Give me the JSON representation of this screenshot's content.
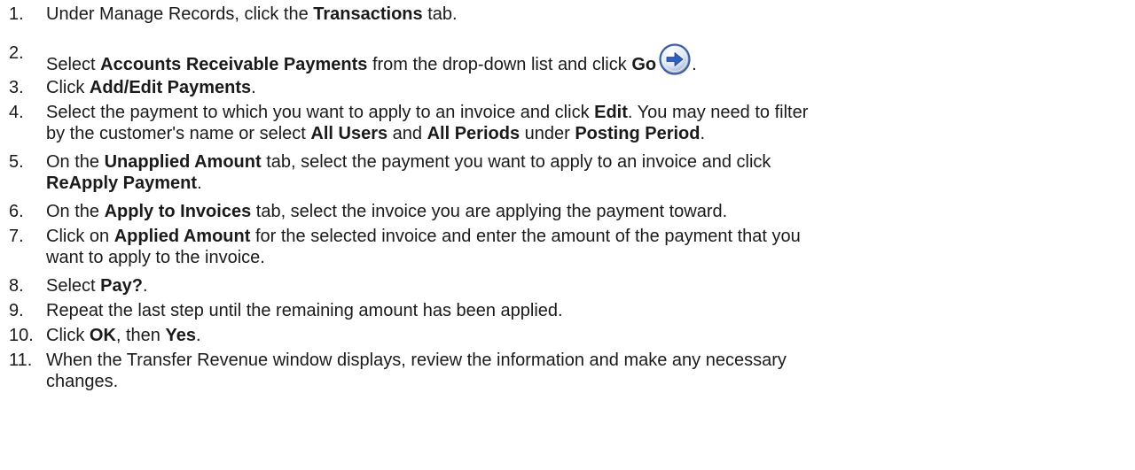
{
  "steps": [
    {
      "num": "1.",
      "lines": [
        [
          {
            "t": "Under Manage Records, click the "
          },
          {
            "t": "Transactions",
            "b": true
          },
          {
            "t": " tab."
          }
        ]
      ]
    },
    {
      "num": "2.",
      "lines": [
        [
          {
            "t": "Select "
          },
          {
            "t": "Accounts Receivable Payments",
            "b": true
          },
          {
            "t": " from the drop-down list and click "
          },
          {
            "t": "Go",
            "b": true
          },
          {
            "icon": "go-arrow-icon"
          },
          {
            "t": "."
          }
        ]
      ]
    },
    {
      "num": "3.",
      "lines": [
        [
          {
            "t": "Click "
          },
          {
            "t": "Add/Edit Payments",
            "b": true
          },
          {
            "t": "."
          }
        ]
      ]
    },
    {
      "num": "4.",
      "lines": [
        [
          {
            "t": "Select the payment to which you want to apply to an invoice and click "
          },
          {
            "t": "Edit",
            "b": true
          },
          {
            "t": ". You may need to filter"
          }
        ],
        [
          {
            "t": "by the customer's name or select "
          },
          {
            "t": "All Users",
            "b": true
          },
          {
            "t": " and "
          },
          {
            "t": "All Periods",
            "b": true
          },
          {
            "t": " under "
          },
          {
            "t": "Posting Period",
            "b": true
          },
          {
            "t": "."
          }
        ]
      ]
    },
    {
      "num": "5.",
      "lines": [
        [
          {
            "t": "On the "
          },
          {
            "t": "Unapplied Amount",
            "b": true
          },
          {
            "t": " tab, select the payment you want to apply to an invoice and click"
          }
        ],
        [
          {
            "t": "ReApply Payment",
            "b": true
          },
          {
            "t": "."
          }
        ]
      ]
    },
    {
      "num": "6.",
      "lines": [
        [
          {
            "t": "On the "
          },
          {
            "t": "Apply to Invoices",
            "b": true
          },
          {
            "t": " tab, select the invoice you are applying the payment toward."
          }
        ]
      ]
    },
    {
      "num": "7.",
      "lines": [
        [
          {
            "t": "Click on "
          },
          {
            "t": "Applied Amount",
            "b": true
          },
          {
            "t": " for the selected invoice and enter the amount of the payment that you"
          }
        ],
        [
          {
            "t": "want to apply to the invoice."
          }
        ]
      ]
    },
    {
      "num": "8.",
      "lines": [
        [
          {
            "t": "Select "
          },
          {
            "t": "Pay?",
            "b": true
          },
          {
            "t": "."
          }
        ]
      ]
    },
    {
      "num": "9.",
      "lines": [
        [
          {
            "t": "Repeat the last step until the remaining amount has been applied."
          }
        ]
      ]
    },
    {
      "num": "10.",
      "lines": [
        [
          {
            "t": "Click "
          },
          {
            "t": "OK",
            "b": true
          },
          {
            "t": ", then "
          },
          {
            "t": "Yes",
            "b": true
          },
          {
            "t": "."
          }
        ]
      ]
    },
    {
      "num": "11.",
      "lines": [
        [
          {
            "t": "When the Transfer Revenue window displays, review the information and make any necessary"
          }
        ],
        [
          {
            "t": "changes."
          }
        ]
      ]
    }
  ]
}
